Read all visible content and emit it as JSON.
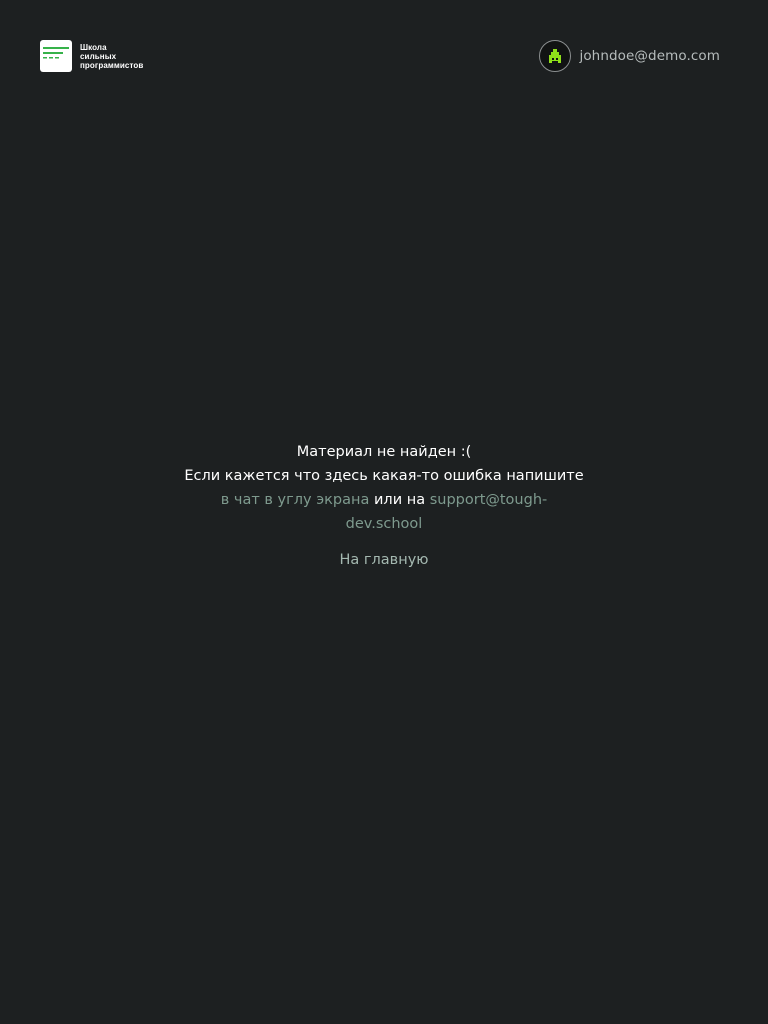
{
  "header": {
    "logo": {
      "line1": "Школа",
      "line2": "сильных",
      "line3": "программистов"
    },
    "user": {
      "email": "johndoe@demo.com",
      "avatar_icon": "pixel-rocket-icon"
    }
  },
  "main": {
    "title": "Материал не найден :(",
    "description": "Если кажется что здесь какая-то ошибка напишите",
    "chat_link": "в чат в углу экрана",
    "connector": "или на",
    "support_line1": "support@tough-",
    "support_line2": "dev.school",
    "home_link": "На главную"
  },
  "colors": {
    "background": "#1d2021",
    "text": "#ffffff",
    "link": "#7e9a8e",
    "logo_accent": "#36b24a",
    "avatar_accent": "#8fe01a"
  }
}
